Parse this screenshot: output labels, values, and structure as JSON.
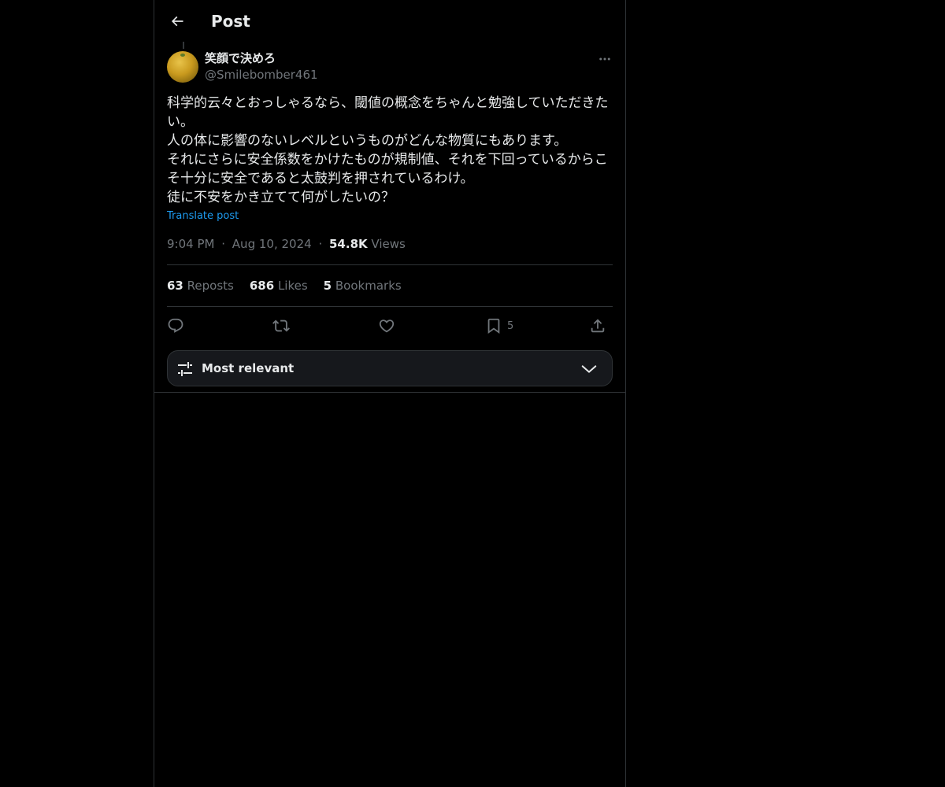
{
  "header": {
    "title": "Post",
    "back_icon": "arrow-left-icon"
  },
  "post": {
    "author": {
      "display_name": "笑顔で決めろ",
      "handle": "@Smilebomber461",
      "avatar": "orange-fruit-avatar"
    },
    "text": "科学的云々とおっしゃるなら、閾値の概念をちゃんと勉強していただきたい。\n人の体に影響のないレベルというものがどんな物質にもあります。\nそれにさらに安全係数をかけたものが規制値、それを下回っているからこそ十分に安全であると太鼓判を押されているわけ。\n徒に不安をかき立てて何がしたいの？",
    "translate_label": "Translate post",
    "time": "9:04 PM",
    "separator": "·",
    "date": "Aug 10, 2024",
    "views_count": "54.8K",
    "views_label": "Views"
  },
  "stats": {
    "reposts_count": "63",
    "reposts_label": "Reposts",
    "likes_count": "686",
    "likes_label": "Likes",
    "bookmarks_count": "5",
    "bookmarks_label": "Bookmarks"
  },
  "actions": {
    "reply_icon": "reply-icon",
    "repost_icon": "repost-icon",
    "like_icon": "heart-icon",
    "bookmark_icon": "bookmark-icon",
    "bookmark_count": "5",
    "share_icon": "share-icon"
  },
  "sort": {
    "label": "Most relevant",
    "icon": "sliders-icon",
    "chevron": "chevron-down-icon"
  },
  "colors": {
    "background": "#000000",
    "text": "#e7e9ea",
    "secondary": "#71767b",
    "link": "#1d9bf0",
    "border": "#2f3336"
  }
}
